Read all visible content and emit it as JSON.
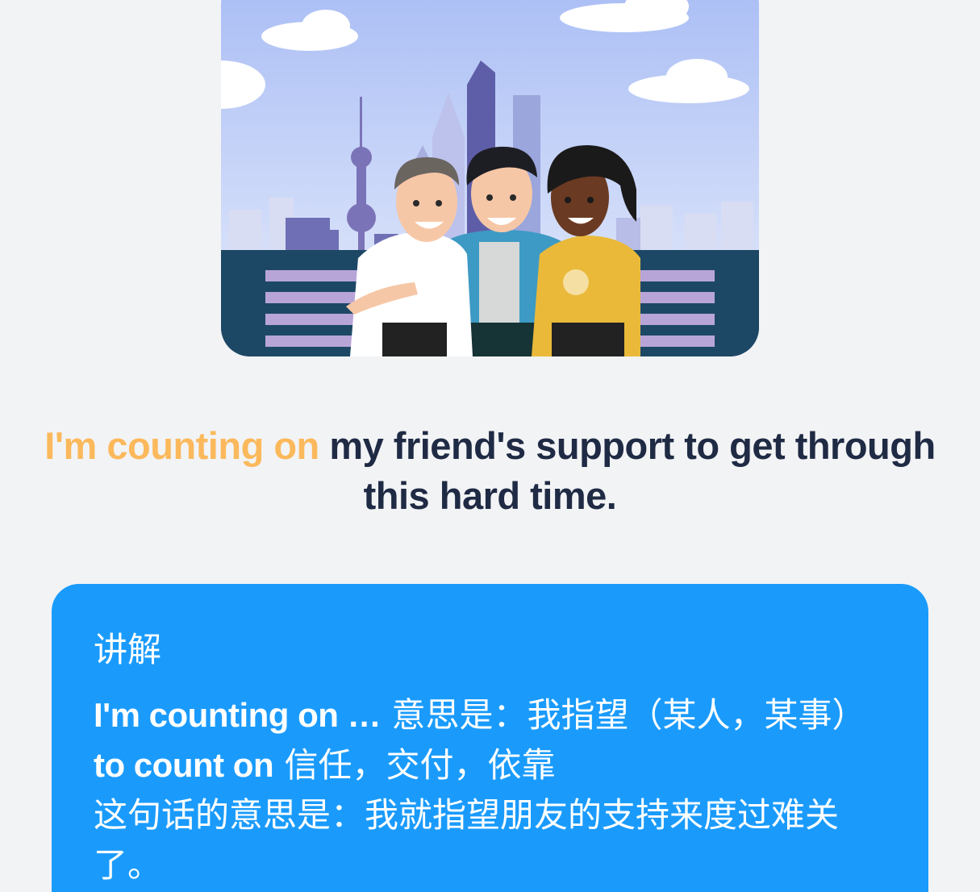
{
  "illustration": {
    "icon": "friends-skyline-illustration"
  },
  "sentence": {
    "highlight": "I'm counting on",
    "rest": " my friend's support to get through this hard time."
  },
  "explanation": {
    "title": "讲解",
    "line1": {
      "en": "I'm counting on …",
      "zh": " 意思是：我指望（某人，某事）"
    },
    "line2": {
      "en": "to count on",
      "zh": " 信任，交付，依靠"
    },
    "line3": "这句话的意思是：我就指望朋友的支持来度过难关了。"
  },
  "colors": {
    "highlight": "#fbb95c",
    "card": "#1a9bfc",
    "text": "#1f2a44",
    "background": "#f2f3f5"
  }
}
